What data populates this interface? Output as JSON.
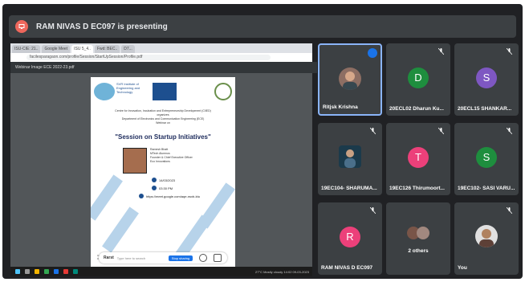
{
  "presenting_text": "RAM NIVAS D EC097 is presenting",
  "colors": {
    "meet_bg": "#202124",
    "tile_bg": "#3c4043",
    "present_icon": "#ee675c"
  },
  "shared_screen": {
    "tabs": [
      "ISU-CIE: 21..",
      "Google Meet",
      "ISU 5_4..",
      "Fwd: BEC..",
      "D7..."
    ],
    "address": "facilesparagaon.com/profile/Session/StartUpSession/Profile.pdf",
    "pdf_title": "Webinar Image ECE 2022-23.pdf",
    "poster": {
      "institution": "SVR Institute of Engineering and Technology",
      "organiser_line": "Centre for Innovation, Incubation and Entrepreneurship Development (CIIED)",
      "department_line": "Department of Electronics and Communication Engineering (ECE)",
      "organizes": "organizes",
      "webinar_line": "Webinar on",
      "session_title": "\"Session on Startup Initiatives\"",
      "speaker_name": "Ramesh Bhatt",
      "speaker_org": "MTech Alumnus",
      "speaker_role": "Founder & Chief Executive Officer",
      "speaker_company": "Eco Innovations",
      "date": "14/03/2023",
      "time": "03:30 PM",
      "link": "https://meet.google.com/aqe-nsxb-ktu",
      "footer_left": "Coordinators: Dr. V. Kailash Kumar, Assistant Professor (Sr Grade), Department of ECE",
      "footer_right": "Chief Patrons: Dr. Shivakumar, Dr. Sai Krishnan"
    },
    "pdf_controls": {
      "app": "Rarst",
      "field": "Type here to search",
      "btn": "Stop sharing"
    },
    "taskbar_sys": "27°C Mostly cloudy  14:02  09-03-2023"
  },
  "participants": [
    {
      "name": "Ritjsk Krishna",
      "type": "photo",
      "speaking": true
    },
    {
      "name": "20ECL02 Dharun Ku...",
      "type": "letter",
      "letter": "D",
      "color": "#1e8e3e"
    },
    {
      "name": "20ECL15 SHANKAR...",
      "type": "letter",
      "letter": "S",
      "color": "#7e57c2"
    },
    {
      "name": "19EC104- SHARUMA...",
      "type": "photo"
    },
    {
      "name": "19EC126 Thirumoort...",
      "type": "letter",
      "letter": "T",
      "color": "#ec407a"
    },
    {
      "name": "19EC102- SASI VARU...",
      "type": "letter",
      "letter": "S",
      "color": "#1e8e3e"
    },
    {
      "name": "RAM NIVAS D EC097",
      "type": "letter",
      "letter": "R",
      "color": "#ec407a"
    },
    {
      "name": "2 others",
      "type": "group"
    },
    {
      "name": "You",
      "type": "photo"
    }
  ]
}
